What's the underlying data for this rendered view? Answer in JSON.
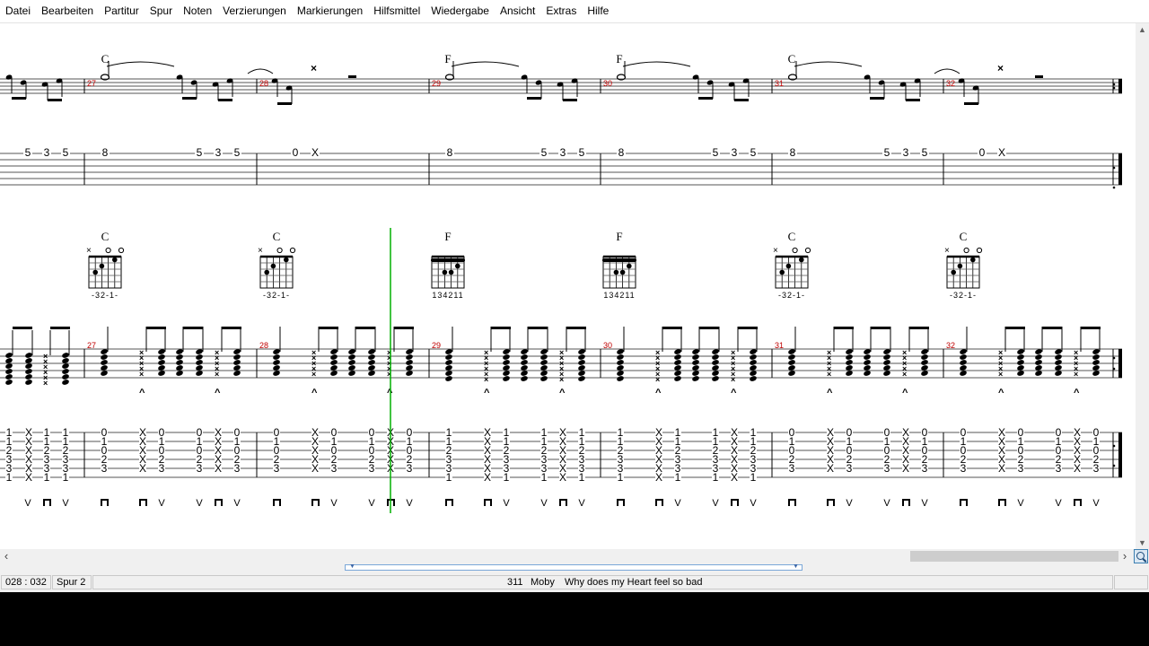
{
  "menu": [
    "Datei",
    "Bearbeiten",
    "Partitur",
    "Spur",
    "Noten",
    "Verzierungen",
    "Markierungen",
    "Hilfsmittel",
    "Wiedergabe",
    "Ansicht",
    "Extras",
    "Hilfe"
  ],
  "status": {
    "position": "028 : 032",
    "track": "Spur 2",
    "song_number": "311",
    "artist": "Moby",
    "title": "Why does my Heart feel so bad"
  },
  "icons": {
    "scroll_left": "chevron-left-icon",
    "scroll_right": "chevron-right-icon",
    "scroll_down": "chevron-down-icon",
    "zoom": "magnifier-icon"
  },
  "colors": {
    "bar_number": "#c00000",
    "cursor": "#00b000"
  },
  "score": {
    "cursor_bar": 28,
    "track1": {
      "bars": [
        {
          "number": 27,
          "chord": "C",
          "tab_line": 2,
          "tab": [
            "8",
            "5",
            "3",
            "5"
          ]
        },
        {
          "number": 28,
          "chord": "",
          "tab_line": 2,
          "tab": [
            "0",
            "X"
          ],
          "rest": true
        },
        {
          "number": 29,
          "chord": "F",
          "tab_line": 2,
          "tab": [
            "8",
            "5",
            "3",
            "5"
          ]
        },
        {
          "number": 30,
          "chord": "F",
          "tab_line": 2,
          "tab": [
            "8",
            "5",
            "3",
            "5"
          ]
        },
        {
          "number": 31,
          "chord": "C",
          "tab_line": 2,
          "tab": [
            "8",
            "5",
            "3",
            "5"
          ]
        },
        {
          "number": 32,
          "chord": "",
          "tab_line": 2,
          "tab": [
            "0",
            "X"
          ],
          "rest": true
        }
      ],
      "pickup_tab": [
        "5",
        "3",
        "5"
      ]
    },
    "track2": {
      "bars": [
        {
          "number": 27,
          "chord": "C",
          "fingering": "-32-1-",
          "mutes": "×  ○ ○"
        },
        {
          "number": 28,
          "chord": "C",
          "fingering": "-32-1-",
          "mutes": "×  ○ ○"
        },
        {
          "number": 29,
          "chord": "F",
          "fingering": "134211",
          "mutes": ""
        },
        {
          "number": 30,
          "chord": "F",
          "fingering": "134211",
          "mutes": ""
        },
        {
          "number": 31,
          "chord": "C",
          "fingering": "-32-1-",
          "mutes": "×  ○ ○"
        },
        {
          "number": 32,
          "chord": "C",
          "fingering": "-32-1-",
          "mutes": "×  ○ ○"
        }
      ],
      "c_shape": [
        "0",
        "1",
        "0",
        "2",
        "3",
        ""
      ],
      "f_shape": [
        "1",
        "1",
        "2",
        "3",
        "3",
        "1"
      ]
    }
  }
}
